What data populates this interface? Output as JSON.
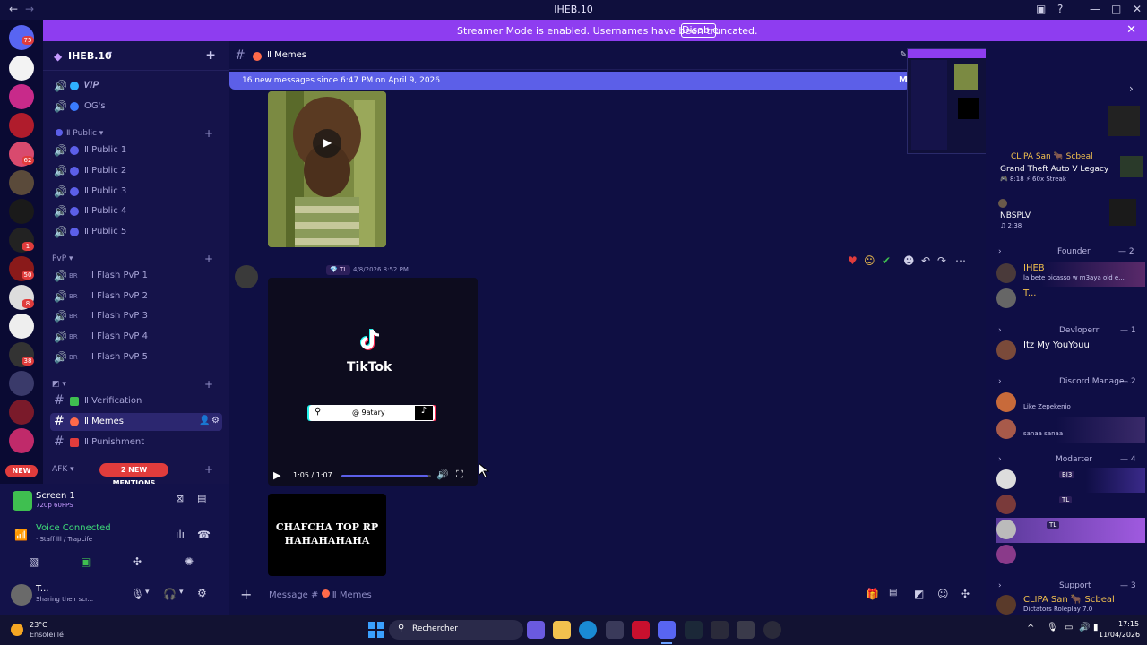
{
  "window": {
    "title": "IHEB.10"
  },
  "banner": {
    "message": "Streamer Mode is enabled. Usernames have been truncated.",
    "button": "Disable"
  },
  "rail": {
    "badges": [
      "75",
      "62",
      "1",
      "50",
      "8",
      "38"
    ],
    "new_label": "NEW"
  },
  "sidebar": {
    "server_name": "IHEB.10",
    "top_channels": [
      {
        "label": "𝑽𝑰𝑷",
        "color": "#2fb0ff"
      },
      {
        "label": "OG's",
        "color": "#3a7bff"
      }
    ],
    "categories": [
      {
        "label": "Public"
      },
      {
        "label": "PvP"
      },
      {
        "label": ""
      },
      {
        "label": "AFK"
      }
    ],
    "public_channels": [
      "Ⅱ Public 1",
      "Ⅱ Public 2",
      "Ⅱ Public 3",
      "Ⅱ Public 4",
      "Ⅱ Public 5"
    ],
    "pvp_prefix": "BR",
    "pvp_channels": [
      "Ⅱ Flash PvP 1",
      "Ⅱ Flash PvP 2",
      "Ⅱ Flash PvP 3",
      "Ⅱ Flash PvP 4",
      "Ⅱ Flash PvP 5"
    ],
    "text_channels": [
      {
        "label": "Ⅱ Verification",
        "emoji_color": "#3fbf50"
      },
      {
        "label": "Ⅱ Memes",
        "emoji_color": "#ff6a4a"
      },
      {
        "label": "Ⅱ Punishment",
        "emoji_color": "#e03c3c"
      }
    ],
    "mentions": "2 NEW MENTIONS"
  },
  "user_panel": {
    "stream_title": "Screen 1",
    "stream_quality": "720p 60FPS",
    "voice_status": "Voice Connected",
    "voice_channel": "· Staff lll / TrapLife",
    "username": "T...",
    "user_status": "Sharing their scr..."
  },
  "chat": {
    "channel_name": "Ⅱ Memes",
    "new_messages": "16 new messages since 6:47 PM on April 9, 2026",
    "author_tag": "TL",
    "timestamp": "4/8/2026 8:52 PM",
    "tiktok_brand": "TikTok",
    "tiktok_handle": "@ 9atary",
    "video_time": "1:05 / 1:07",
    "video_progress": 0.97,
    "meme_caption": "CHAFCHA TOP RP HAHAHAHAHA",
    "composer_placeholder": "Message #",
    "composer_channel": "Ⅱ Memes"
  },
  "members": {
    "activities": [
      {
        "name": "CLIPA San 🐂 Scbeal",
        "detail": "Grand Theft Auto V Legacy",
        "meta": "8:18 ⚡ 60x Streak"
      },
      {
        "name": "NBSPLV",
        "detail": "",
        "meta": "♫ 2:38"
      }
    ],
    "groups": [
      {
        "label": "Founder",
        "count": "— 2"
      },
      {
        "label": "Devloperr",
        "count": "— 1"
      },
      {
        "label": "Discord Manage...",
        "count": "— 2"
      },
      {
        "label": "Modarter",
        "count": "— 4"
      },
      {
        "label": "Support",
        "count": "— 3"
      }
    ],
    "people": [
      {
        "name": "IHEB",
        "status": "la bete picasso w m3aya old e..."
      },
      {
        "name": "T...",
        "status": ""
      },
      {
        "name": "Itz My YouYouu",
        "status": ""
      },
      {
        "name": "",
        "status": "Like Zepekenio"
      },
      {
        "name": "",
        "status": "sanaa sanaa"
      },
      {
        "name": "",
        "tag": "BI3"
      },
      {
        "name": "",
        "tag": "TL"
      },
      {
        "name": "",
        "tag": "TL"
      },
      {
        "name": "",
        "status": ""
      },
      {
        "name": "CLIPA San 🐂 Scbeal",
        "status": "Dictators Roleplay 7.0"
      }
    ]
  },
  "taskbar": {
    "weather_temp": "23°C",
    "weather_desc": "Ensoleillé",
    "search_placeholder": "Rechercher",
    "time": "17:15",
    "date": "11/04/2026"
  }
}
